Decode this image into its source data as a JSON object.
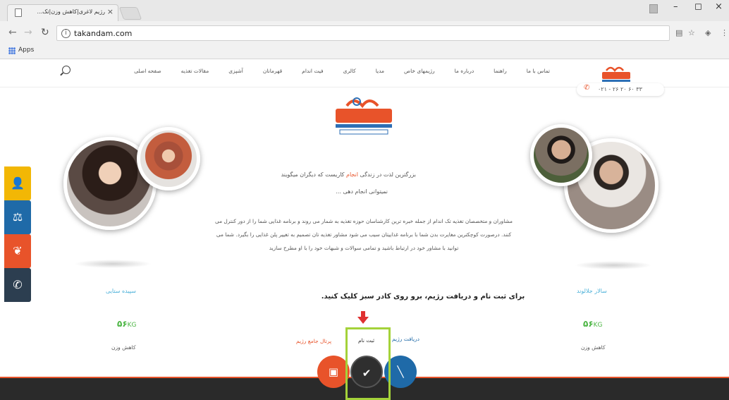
{
  "browser": {
    "tab_title": "رژیم لاغری|کاهش وزن|تک...",
    "tab_close": "×",
    "url": "takandam.com",
    "bookmarks_apps": "Apps",
    "window_controls": [
      "–",
      "◻",
      "×"
    ]
  },
  "site": {
    "menu": [
      "صفحه اصلی",
      "مقالات تغذیه",
      "آشپزی",
      "قهرمانان",
      "فیت اندام",
      "کالری",
      "مدیا",
      "رژیمهای خاص",
      "درباره ما",
      "راهنما",
      "تماس با ما"
    ],
    "phone": "۰۲۱ - ۲۶ ۲۰ ۶۰ ۳۳",
    "intro_line1_before": "بزرگترین لذت در زندگی ",
    "intro_highlight": "انجام",
    "intro_line1_after": " کاریست که دیگران میگویند",
    "intro_line2": "نمیتوانی انجام دهی ...",
    "description": "مشاوران و متخصصان تغذیه تک اندام از جمله خبره ترین کارشناسان حوزه تغذیه به شمار می روند و برنامه غذایی شما را از دور کنترل می کنند. درصورت کوچکترین مغایرت بدن شما با برنامه غذاییتان سیب می شود مشاور تغذیه تان تصمیم به تغییر پلن غذایی را بگیرد. شما می توانید با مشاور خود در ارتباط باشید و تمامی سوالات و شبهات خود را با او مطرح سازید",
    "left_person": {
      "name": "سپیده ستایی",
      "kg": "۵۶",
      "kg_unit": "KG",
      "sub": "کاهش وزن"
    },
    "right_person": {
      "name": "سالار جلالوند",
      "kg": "۵۶",
      "kg_unit": "KG",
      "sub": "کاهش وزن"
    },
    "cta": "برای ثبت نام و دریافت رژیم، برو روی کادر سبز کلیک کنید.",
    "links": {
      "receive_diet": "دریافت رژیم",
      "register": "ثبت نام",
      "portal": "پرتال جامع رژیم"
    },
    "circle_buttons": {
      "left": "▣",
      "center": "✔",
      "right": "╲"
    },
    "colors": {
      "accent_orange": "#e8532a",
      "highlight_green": "#a4d23a",
      "kg_green": "#4bb543",
      "name_blue": "#4ab0d8",
      "footer_dark": "#2a2a2a"
    }
  }
}
